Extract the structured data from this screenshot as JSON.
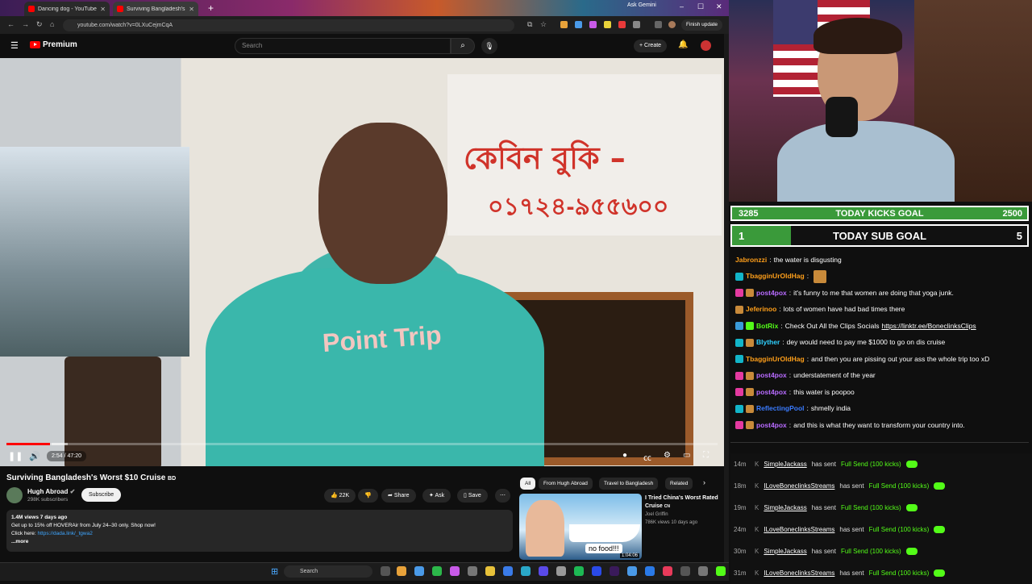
{
  "browser": {
    "tabs": [
      {
        "label": "Dancing dog - YouTube"
      },
      {
        "label": "Surviving Bangladesh's Wo..."
      }
    ],
    "url": "youtube.com/watch?v=0LXuCejmCqA",
    "ask_gemini": "Ask Gemini",
    "finish_update": "Finish update"
  },
  "youtube": {
    "logo_text": "Premium",
    "search_placeholder": "Search",
    "create_label": "Create",
    "player": {
      "time": "2:54 / 47:20",
      "progress_fraction": 0.061
    },
    "video": {
      "title": "Surviving Bangladesh's Worst $10 Cruise",
      "title_tag": "BD",
      "channel": "Hugh Abroad",
      "subscribers": "298K subscribers",
      "subscribe_label": "Subscribe",
      "likes": "22K",
      "share_label": "Share",
      "ask_label": "Ask",
      "save_label": "Save",
      "description": {
        "meta": "1.4M views  7 days ago",
        "line1": "Get up to 15% off HOVERAir from July 24–30 only. Shop now!",
        "line2_prefix": "Click here: ",
        "line2_link": "https://dada.link/_tgwa2",
        "more": "...more"
      },
      "overlay_text": {
        "sign_bengali": "কেবিন বুকি –",
        "sign_number": "০১৭২৪-৯৫৫৬০০",
        "shirt": "Point Trip"
      }
    },
    "related": {
      "chips": [
        "All",
        "From Hugh Abroad",
        "Travel to Bangladesh",
        "Related"
      ],
      "item": {
        "title": "I Tried China's Worst Rated Cruise",
        "title_tag": "CN",
        "channel": "Joel Griffin",
        "meta": "786K views  10 days ago",
        "duration": "1:04:06",
        "thumb_text": "no food!!!"
      }
    }
  },
  "taskbar": {
    "search_label": "Search"
  },
  "stream": {
    "kicks_goal": {
      "current": "3285",
      "label": "TODAY KICKS GOAL",
      "target": "2500",
      "progress_fraction": 1.0
    },
    "sub_goal": {
      "current": "1",
      "label": "TODAY SUB GOAL",
      "target": "5",
      "progress_fraction": 0.2
    },
    "chat": [
      {
        "user": "Jabronzzi",
        "color": "#ff9f1a",
        "message": "the water is disgusting",
        "badges": []
      },
      {
        "user": "TbagginUrOldHag",
        "color": "#ff9f1a",
        "message": "",
        "badges": [
          "#12b5c9"
        ]
      },
      {
        "user": "post4pox",
        "color": "#b86bff",
        "message": "it's funny to me that women are doing that yoga junk.",
        "badges": [
          "#e43aa0",
          "#c88a3a"
        ]
      },
      {
        "user": "Jeferinoo",
        "color": "#ff9f1a",
        "message": "lots of women have had bad times there",
        "badges": [
          "#c88a3a"
        ]
      },
      {
        "user": "BotRix",
        "color": "#53fc18",
        "message": "Check Out All the Clips Socials ",
        "link": "https://linktr.ee/BoneclinksClips",
        "badges": [
          "#3a9ad9",
          "#53fc18"
        ]
      },
      {
        "user": "Blyther",
        "color": "#2fd1ff",
        "message": "dey would need to pay me $1000 to go on dis cruise",
        "badges": [
          "#12b5c9",
          "#c88a3a"
        ]
      },
      {
        "user": "TbagginUrOldHag",
        "color": "#ff9f1a",
        "message": "and then you are pissing out your ass the whole trip too xD",
        "badges": [
          "#12b5c9"
        ]
      },
      {
        "user": "post4pox",
        "color": "#b86bff",
        "message": "understatement of the year",
        "badges": [
          "#e43aa0",
          "#c88a3a"
        ]
      },
      {
        "user": "post4pox",
        "color": "#b86bff",
        "message": "this water is poopoo",
        "badges": [
          "#e43aa0",
          "#c88a3a"
        ]
      },
      {
        "user": "ReflectingPool",
        "color": "#3a7bff",
        "message": "shmelly india",
        "badges": [
          "#12b5c9",
          "#c88a3a"
        ]
      },
      {
        "user": "post4pox",
        "color": "#b86bff",
        "message": "and this is what they want to transform your country into.",
        "badges": [
          "#e43aa0",
          "#c88a3a"
        ]
      }
    ],
    "events": [
      {
        "time": "14m",
        "user": "SimpleJackass",
        "action": "has sent",
        "item": "Full Send (100 kicks)"
      },
      {
        "time": "18m",
        "user": "ILoveBoneclinksStreams",
        "action": "has sent",
        "item": "Full Send (100 kicks)"
      },
      {
        "time": "19m",
        "user": "SimpleJackass",
        "action": "has sent",
        "item": "Full Send (100 kicks)"
      },
      {
        "time": "24m",
        "user": "ILoveBoneclinksStreams",
        "action": "has sent",
        "item": "Full Send (100 kicks)"
      },
      {
        "time": "30m",
        "user": "SimpleJackass",
        "action": "has sent",
        "item": "Full Send (100 kicks)"
      },
      {
        "time": "31m",
        "user": "ILoveBoneclinksStreams",
        "action": "has sent",
        "item": "Full Send (100 kicks)"
      }
    ]
  },
  "icons": {
    "accent_red": "#ff0000",
    "kick_green": "#53fc18",
    "link_blue": "#3ea6ff"
  }
}
